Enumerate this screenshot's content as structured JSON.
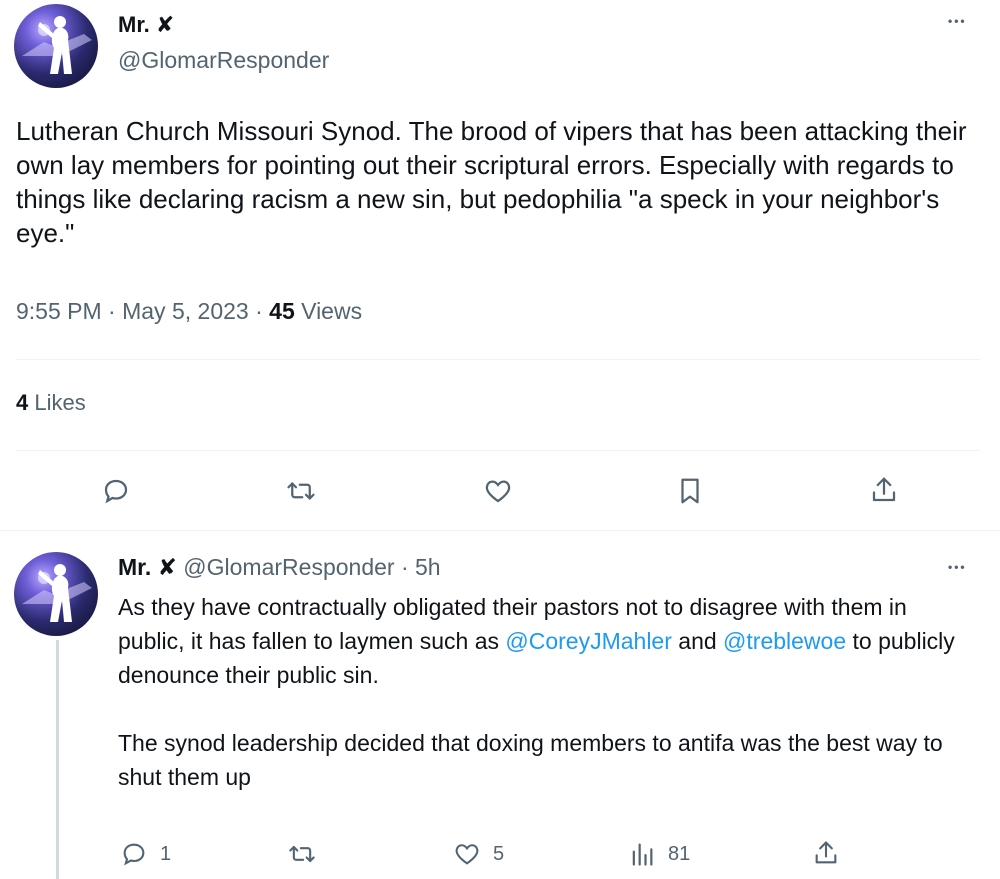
{
  "main_tweet": {
    "author_name": "Mr. ✘",
    "author_handle": "@GlomarResponder",
    "more_label": "•••",
    "text": "Lutheran Church Missouri Synod. The brood of vipers that has been attacking their own lay members for pointing out their scriptural errors. Especially with regards to things like declaring racism a new sin, but pedophilia \"a speck in your neighbor's eye.\"",
    "time": "9:55 PM",
    "separator": "·",
    "date": "May 5, 2023",
    "views_count": "45",
    "views_label": "Views",
    "likes_count": "4",
    "likes_label": "Likes",
    "actions": [
      "reply-icon",
      "retweet-icon",
      "like-icon",
      "bookmark-icon",
      "share-icon"
    ]
  },
  "reply": {
    "author_name": "Mr. ✘",
    "author_handle": "@GlomarResponder",
    "time_ago": "· 5h",
    "more_label": "•••",
    "text_part1": "As they have contractually obligated their pastors not to disagree with them in public, it has fallen to laymen such as ",
    "mention1": "@CoreyJMahler",
    "text_part2": " and ",
    "mention2": "@treblewoe",
    "text_part3": " to publicly denounce their public sin.",
    "text_paragraph2": "The synod leadership decided that doxing members to antifa was the best way to shut them up",
    "reply_count": "1",
    "like_count": "5",
    "views_count": "81"
  },
  "colors": {
    "text_primary": "#0f1419",
    "text_secondary": "#536471",
    "accent": "#1d9bf0",
    "divider": "#eff3f4"
  }
}
